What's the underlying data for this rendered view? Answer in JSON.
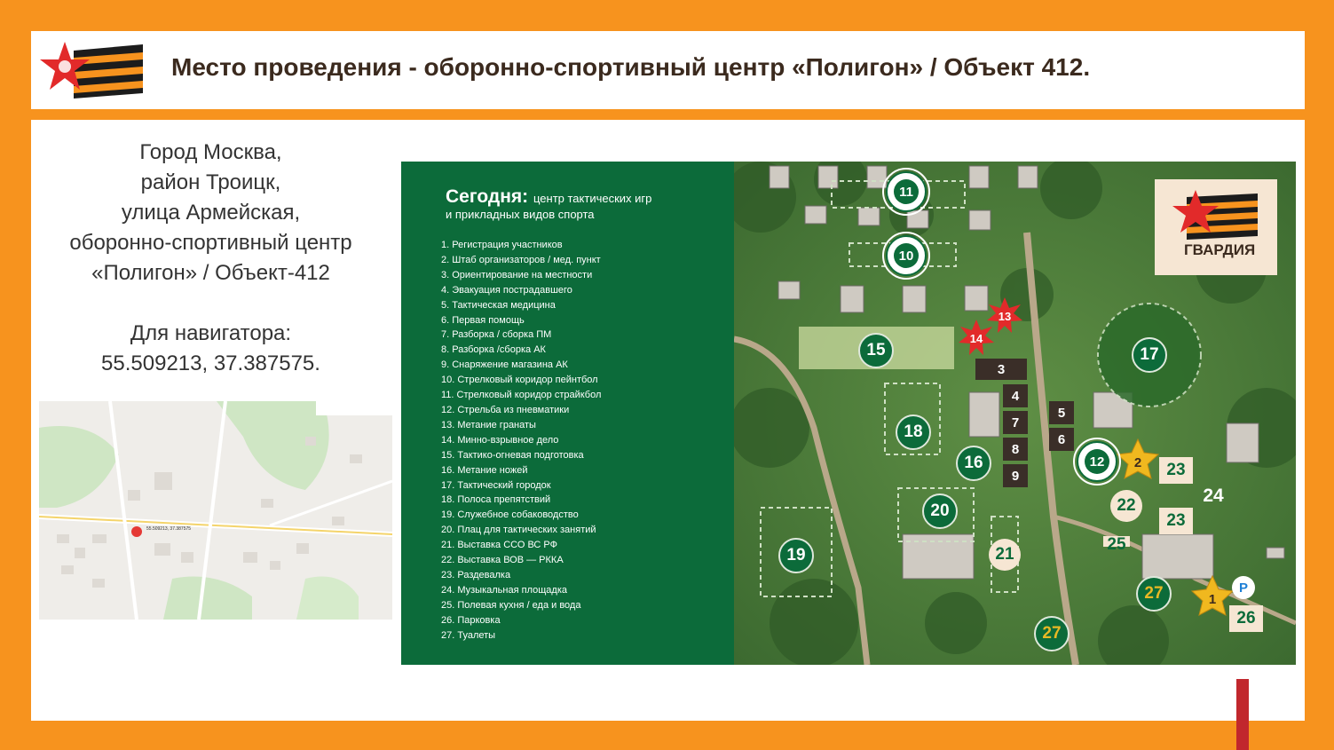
{
  "header": {
    "title": "Место проведения - оборонно-спортивный центр «Полигон» / Объект 412."
  },
  "address": {
    "lines": [
      "Город Москва,",
      "район Троицк,",
      "улица Армейская,",
      "оборонно-спортивный центр",
      "«Полигон» / Объект-412"
    ],
    "nav_label": "Для навигатора:",
    "coords": "55.509213, 37.387575."
  },
  "minimap": {
    "pin_label": "55.509213, 37.387575"
  },
  "panel": {
    "title_big": "Сегодня:",
    "title_small": "центр тактических игр",
    "subtitle": "и прикладных видов спорта",
    "items": [
      "1. Регистрация участников",
      "2. Штаб организаторов / мед. пункт",
      "3. Ориентирование на местности",
      "4. Эвакуация пострадавшего",
      "5. Тактическая медицина",
      "6. Первая помощь",
      "7. Разборка / сборка ПМ",
      "8. Разборка /сборка АК",
      "9. Снаряжение магазина АК",
      "10. Стрелковый коридор пейнтбол",
      "11. Стрелковый коридор страйкбол",
      "12. Стрельба из пневматики",
      "13. Метание гранаты",
      "14. Минно-взрывное дело",
      "15. Тактико-огневая подготовка",
      "16. Метание ножей",
      "17. Тактический городок",
      "18. Полоса препятствий",
      "19. Служебное собаководство",
      "20. Плац для тактических занятий",
      "21. Выставка ССО ВС РФ",
      "22. Выставка ВОВ — РККА",
      "23. Раздевалка",
      "24. Музыкальная площадка",
      "25. Полевая кухня / еда и вода",
      "26. Парковка",
      "27. Туалеты"
    ]
  },
  "aerial": {
    "logo_text": "ГВАРДИЯ",
    "markers": [
      "1",
      "2",
      "3",
      "4",
      "5",
      "6",
      "7",
      "8",
      "9",
      "10",
      "11",
      "12",
      "13",
      "14",
      "15",
      "16",
      "17",
      "18",
      "19",
      "20",
      "21",
      "22",
      "23",
      "23",
      "24",
      "25",
      "26",
      "27",
      "27",
      "P"
    ]
  },
  "colors": {
    "orange": "#f7931e",
    "green": "#0c6b3a",
    "title_brown": "#3b2a1e",
    "red": "#c1272d",
    "cream": "#f6e6d3"
  }
}
